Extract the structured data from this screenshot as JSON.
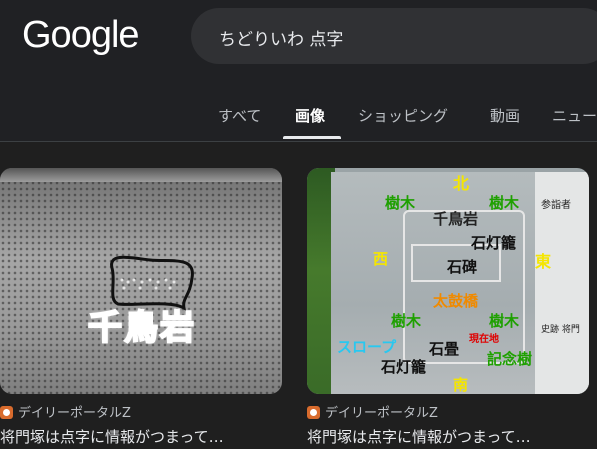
{
  "header": {
    "logo": "Google",
    "search_query": "ちどりいわ 点字"
  },
  "tabs": [
    {
      "label": "すべて",
      "active": false
    },
    {
      "label": "画像",
      "active": true
    },
    {
      "label": "ショッピング",
      "active": false
    },
    {
      "label": "動画",
      "active": false
    },
    {
      "label": "ニュー",
      "active": false
    }
  ],
  "results": [
    {
      "image_text": "千鳥岩",
      "source": "デイリーポータルZ",
      "title": "将門塚は点字に情報がつまって…"
    },
    {
      "image_labels": {
        "north": "北",
        "south": "南",
        "east": "東",
        "west": "西",
        "tree": "樹木",
        "chidoriiwa": "千鳥岩",
        "lantern": "石灯籠",
        "stele": "石碑",
        "bridge": "太鼓橋",
        "slope": "スロープ",
        "paving": "石畳",
        "memorial_tree": "記念樹",
        "current_location": "現在地",
        "sign_header": "参詣者",
        "sign_footer": "史跡 将門"
      },
      "source": "デイリーポータルZ",
      "title": "将門塚は点字に情報がつまって…"
    }
  ],
  "colors": {
    "background": "#1f1f1f",
    "search_bg": "#303134",
    "tree_label": "#1ea000",
    "bridge_label": "#f08a00",
    "slope_label": "#28c8f0",
    "direction_label": "#f5e600",
    "title_red": "#e00000"
  }
}
